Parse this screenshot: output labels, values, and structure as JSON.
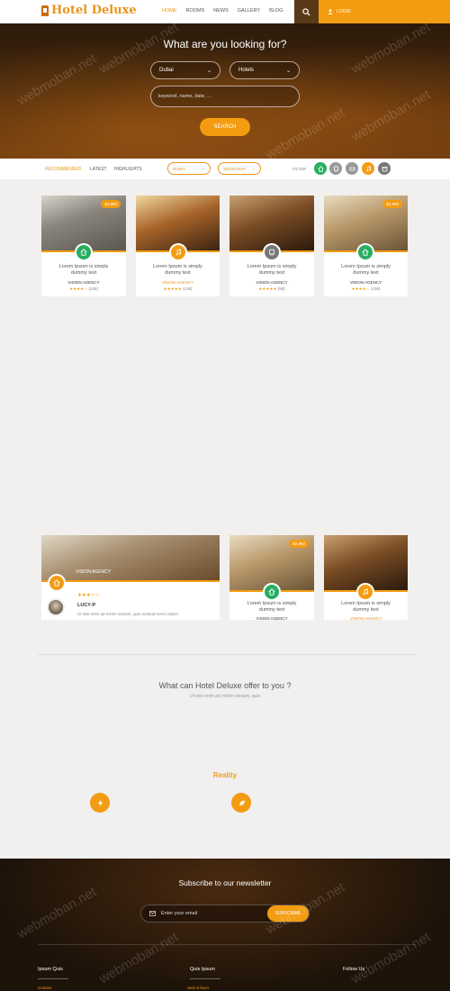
{
  "brand": {
    "name": "Hotel Deluxe"
  },
  "nav": {
    "home": "HOME",
    "rooms": "ROOMS",
    "news": "NEWS",
    "gallery": "GALLERY",
    "blog": "BLOG"
  },
  "header": {
    "login": "LOGIN"
  },
  "hero": {
    "title": "What are you looking for?",
    "location": "Dubai",
    "type": "Hotels",
    "search_placeholder": "keyword, name, date, ...",
    "search_button": "SEARCH"
  },
  "filterbar": {
    "tabs": [
      "RECOMMENDED",
      "LATEST",
      "HIGHLIGHTS"
    ],
    "city": "DUBAI",
    "map": "SHOW MAP",
    "filter_label": "FILTER"
  },
  "cards": [
    {
      "price": "$2,960",
      "text": "Lorem Ipsum is simply dummy text",
      "agency": "VISION AGENCY",
      "stars": "★★★★☆",
      "count": "(238)",
      "category_icon": "home-icon",
      "color": "#27ae60"
    },
    {
      "text": "Lorem Ipsum is simply dummy text",
      "agency": "VISION AGENCY",
      "stars": "★★★★★",
      "count": "(138)",
      "category_icon": "music-icon",
      "color": "#f39c12"
    },
    {
      "text": "Lorem Ipsum is simply dummy text",
      "agency": "VISION AGENCY",
      "stars": "★★★★★",
      "count": "(58)",
      "category_icon": "bus-icon",
      "color": "#777777"
    },
    {
      "price": "$2,960",
      "text": "Lorem Ipsum is simply dummy text",
      "agency": "VISION AGENCY",
      "stars": "★★★★☆",
      "count": "(238)",
      "category_icon": "home-icon",
      "color": "#27ae60"
    }
  ],
  "featured": {
    "agency": "VISION AGENCY",
    "stars": "★★★☆☆",
    "reviewer": "LUCY-P",
    "review": "Ut wisi enim ad minim veniam, quis nostrud exerci tation"
  },
  "cards2": [
    {
      "price": "$2,960",
      "text": "Lorem Ipsum is simply dummy text",
      "agency": "VISION AGENCY"
    },
    {
      "text": "Lorem Ipsum is simply dummy text",
      "agency": "VISION AGENCY"
    }
  ],
  "offer": {
    "title": "What can Hotel Deluxe offer to you ?",
    "subtitle": "Ut wisi enim ad minim veniam, quis"
  },
  "reality": "Reality",
  "newsletter": {
    "title": "Subscribe to our newsletter",
    "placeholder": "Enter your email",
    "button": "SUBSCRIBE"
  },
  "footer": {
    "col1": "Ipsum Quis",
    "col1_link": "Contact",
    "col2": "Quis Ipsum",
    "col2_link": "Sed ut facer",
    "col3": "Follow Us"
  },
  "watermark": "webmoban.net",
  "colors": {
    "accent": "#f39c12",
    "green": "#27ae60"
  }
}
